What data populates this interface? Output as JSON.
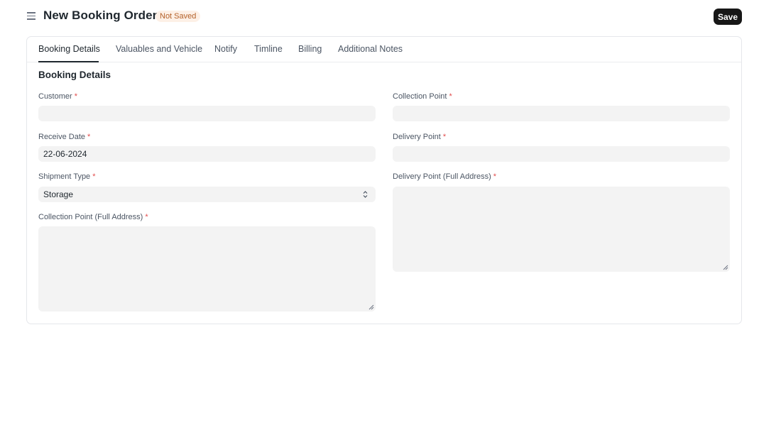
{
  "header": {
    "title": "New Booking Order",
    "status_badge": "Not Saved",
    "save_label": "Save"
  },
  "tabs": [
    {
      "label": "Booking Details",
      "active": true
    },
    {
      "label": "Valuables and Vehicle",
      "active": false
    },
    {
      "label": "Notify",
      "active": false
    },
    {
      "label": "Timline",
      "active": false
    },
    {
      "label": "Billing",
      "active": false
    },
    {
      "label": "Additional Notes",
      "active": false
    }
  ],
  "section": {
    "title": "Booking Details"
  },
  "fields": {
    "customer": {
      "label": "Customer",
      "required_mark": "*",
      "value": ""
    },
    "receive_date": {
      "label": "Receive Date",
      "required_mark": "*",
      "value": "22-06-2024"
    },
    "shipment_type": {
      "label": "Shipment Type",
      "required_mark": "*",
      "value": "Storage"
    },
    "collection_point_full_address": {
      "label": "Collection Point (Full Address)",
      "required_mark": "*",
      "value": ""
    },
    "collection_point": {
      "label": "Collection Point",
      "required_mark": "*",
      "value": ""
    },
    "delivery_point": {
      "label": "Delivery Point",
      "required_mark": "*",
      "value": ""
    },
    "delivery_point_full_address": {
      "label": "Delivery Point (Full Address)",
      "required_mark": "*",
      "value": ""
    }
  },
  "colors": {
    "accent": "#171717",
    "badge_bg": "#fdf0e6",
    "badge_text": "#b4612a",
    "required": "#e24c4c",
    "input_bg": "#f3f3f3"
  },
  "icons": {
    "menu": "hamburger-menu-icon",
    "select": "chevron-up-down-icon",
    "resize": "resize-grip-icon"
  }
}
